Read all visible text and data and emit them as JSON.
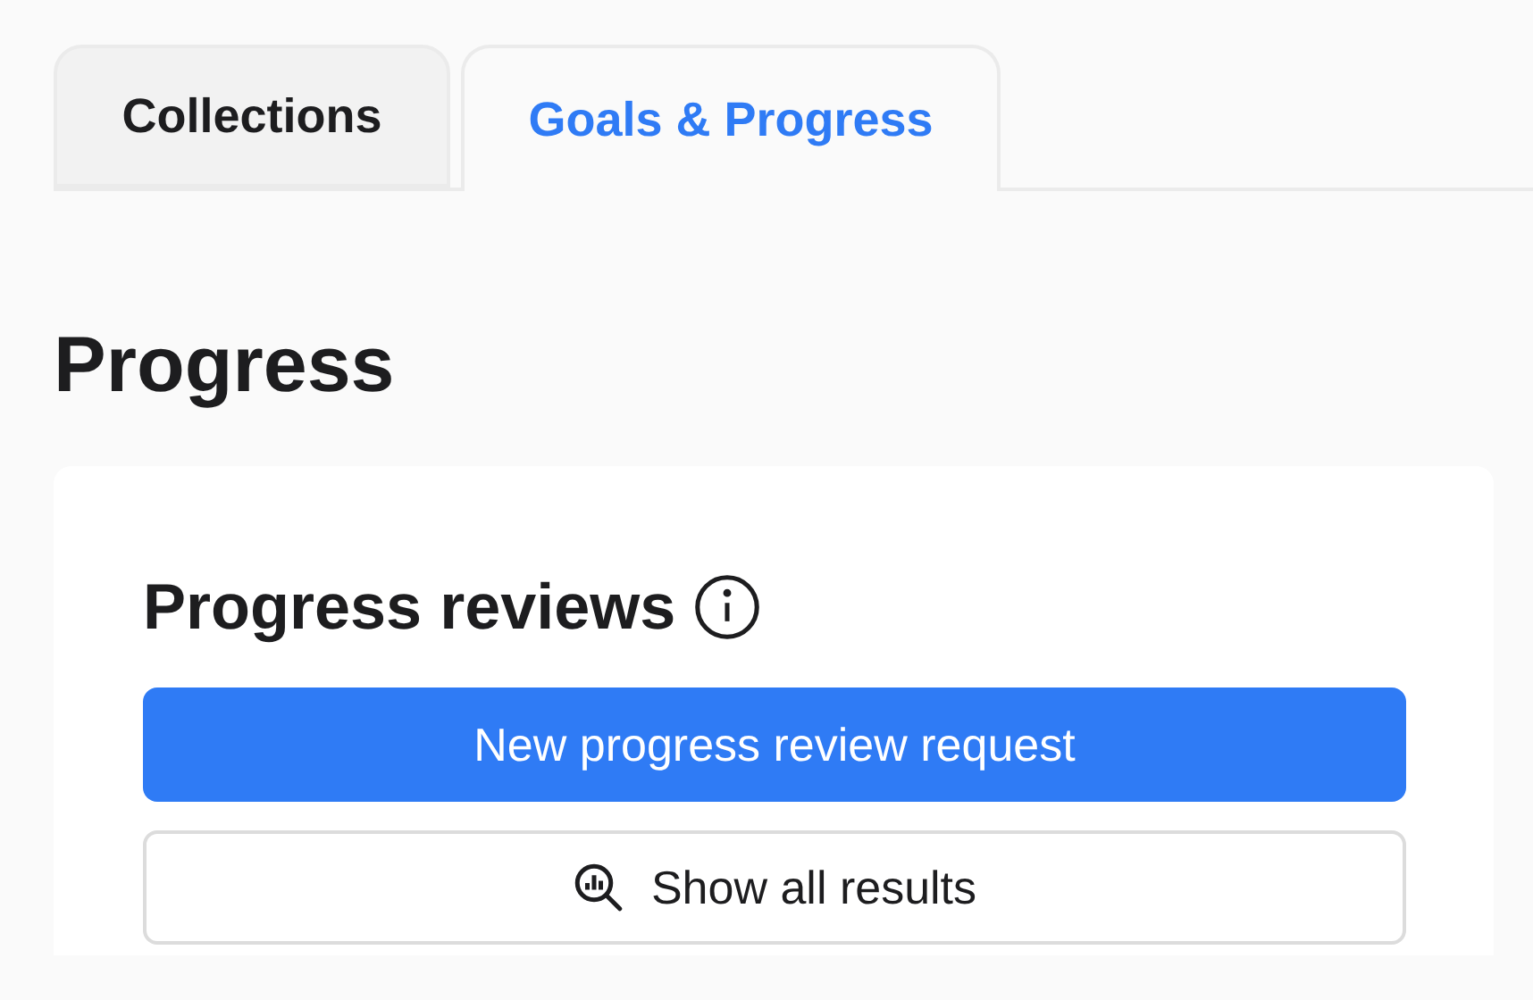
{
  "tabs": [
    {
      "label": "Collections",
      "selected": false
    },
    {
      "label": "Goals & Progress",
      "selected": true
    }
  ],
  "page_title": "Progress",
  "card": {
    "title": "Progress reviews",
    "buttons": [
      {
        "label": "New progress review request",
        "kind": "primary"
      },
      {
        "label": "Show all results",
        "kind": "secondary"
      }
    ]
  }
}
